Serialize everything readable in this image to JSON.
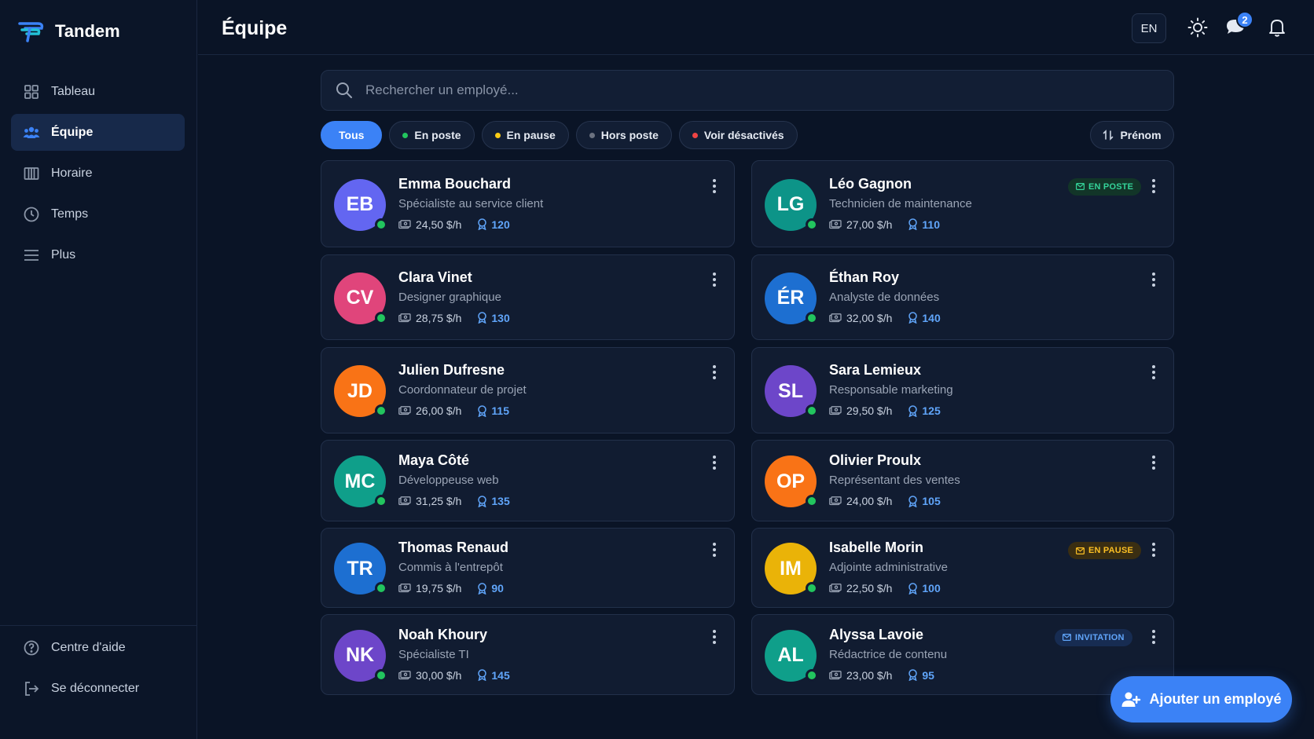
{
  "app": {
    "name": "Tandem"
  },
  "sidebar": {
    "items": [
      {
        "label": "Tableau",
        "icon": "grid-icon",
        "active": false
      },
      {
        "label": "Équipe",
        "icon": "team-icon",
        "active": true
      },
      {
        "label": "Horaire",
        "icon": "schedule-icon",
        "active": false
      },
      {
        "label": "Temps",
        "icon": "clock-icon",
        "active": false
      },
      {
        "label": "Plus",
        "icon": "menu-icon",
        "active": false
      }
    ],
    "bottom": [
      {
        "label": "Centre d'aide",
        "icon": "help-icon"
      },
      {
        "label": "Se déconnecter",
        "icon": "logout-icon"
      }
    ]
  },
  "header": {
    "title": "Équipe",
    "lang": "EN",
    "messages_badge": "2"
  },
  "search": {
    "placeholder": "Rechercher un employé..."
  },
  "filters": [
    {
      "label": "Tous",
      "active": true,
      "dot": ""
    },
    {
      "label": "En poste",
      "active": false,
      "dot": "#22c55e"
    },
    {
      "label": "En pause",
      "active": false,
      "dot": "#facc15"
    },
    {
      "label": "Hors poste",
      "active": false,
      "dot": "#6b7280"
    },
    {
      "label": "Voir désactivés",
      "active": false,
      "dot": "#ef4444"
    }
  ],
  "sort": {
    "label": "Prénom"
  },
  "employees": [
    {
      "initials": "EB",
      "name": "Emma Bouchard",
      "role": "Spécialiste au service client",
      "rate": "24,50 $/h",
      "points": "120",
      "color": "#6366f1",
      "tag": ""
    },
    {
      "initials": "LG",
      "name": "Léo Gagnon",
      "role": "Technicien de maintenance",
      "rate": "27,00 $/h",
      "points": "110",
      "color": "#0d9488",
      "tag": "EN POSTE",
      "tag_style": "green"
    },
    {
      "initials": "CV",
      "name": "Clara Vinet",
      "role": "Designer graphique",
      "rate": "28,75 $/h",
      "points": "130",
      "color": "#e0457b",
      "tag": ""
    },
    {
      "initials": "ÉR",
      "name": "Éthan Roy",
      "role": "Analyste de données",
      "rate": "32,00 $/h",
      "points": "140",
      "color": "#1d6fd1",
      "tag": ""
    },
    {
      "initials": "JD",
      "name": "Julien Dufresne",
      "role": "Coordonnateur de projet",
      "rate": "26,00 $/h",
      "points": "115",
      "color": "#f97316",
      "tag": ""
    },
    {
      "initials": "SL",
      "name": "Sara Lemieux",
      "role": "Responsable marketing",
      "rate": "29,50 $/h",
      "points": "125",
      "color": "#6d46c9",
      "tag": ""
    },
    {
      "initials": "MC",
      "name": "Maya Côté",
      "role": "Développeuse web",
      "rate": "31,25 $/h",
      "points": "135",
      "color": "#0f9f8a",
      "tag": ""
    },
    {
      "initials": "OP",
      "name": "Olivier Proulx",
      "role": "Représentant des ventes",
      "rate": "24,00 $/h",
      "points": "105",
      "color": "#f97316",
      "tag": ""
    },
    {
      "initials": "TR",
      "name": "Thomas Renaud",
      "role": "Commis à l'entrepôt",
      "rate": "19,75 $/h",
      "points": "90",
      "color": "#1d6fd1",
      "tag": ""
    },
    {
      "initials": "IM",
      "name": "Isabelle Morin",
      "role": "Adjointe administrative",
      "rate": "22,50 $/h",
      "points": "100",
      "color": "#eab308",
      "tag": "EN PAUSE",
      "tag_style": "amber"
    },
    {
      "initials": "NK",
      "name": "Noah Khoury",
      "role": "Spécialiste TI",
      "rate": "30,00 $/h",
      "points": "145",
      "color": "#6d46c9",
      "tag": ""
    },
    {
      "initials": "AL",
      "name": "Alyssa Lavoie",
      "role": "Rédactrice de contenu",
      "rate": "23,00 $/h",
      "points": "95",
      "color": "#0f9f8a",
      "tag": "INVITATION",
      "tag_style": "blue"
    }
  ],
  "fab": {
    "label": "Ajouter un employé"
  }
}
